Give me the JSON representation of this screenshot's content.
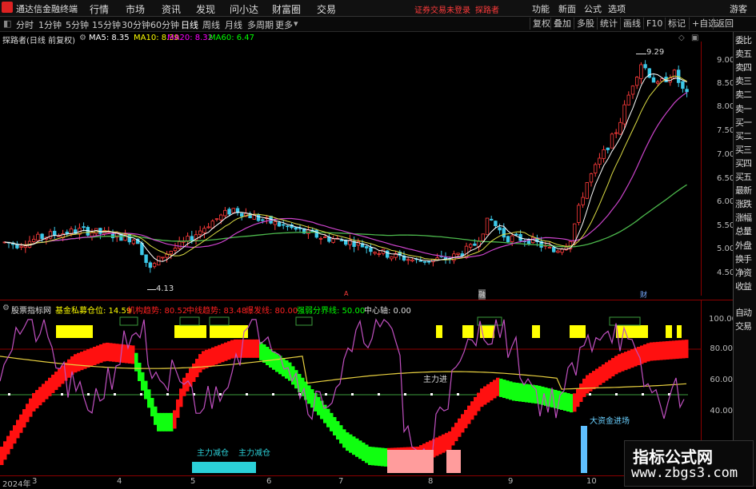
{
  "titlebar": {
    "app_title": "通达信金融终端",
    "menus": [
      "行情",
      "市场",
      "资讯",
      "发现",
      "问小达",
      "财富圈",
      "交易"
    ],
    "notice": "证券交易未登录",
    "user": "探路者",
    "right_buttons": [
      "功能",
      "新面",
      "公式",
      "选项",
      "游客"
    ]
  },
  "toolbar": {
    "periods": [
      "分时",
      "1分钟",
      "5分钟",
      "15分钟",
      "30分钟",
      "60分钟",
      "日线",
      "周线",
      "月线",
      "多周期",
      "更多"
    ],
    "active_period": "日线",
    "tools": [
      "复权",
      "叠加",
      "多股",
      "统计",
      "画线",
      "F10",
      "标记",
      "+自选",
      "返回"
    ]
  },
  "main_chart": {
    "stock_title": "探路者(日线 前复权)",
    "ma": [
      {
        "label": "MA5: 8.35",
        "color": "#ffffff"
      },
      {
        "label": "MA10: 8.39",
        "color": "#ffff00"
      },
      {
        "label": "MA20: 8.32",
        "color": "#ff00ff"
      },
      {
        "label": "MA60: 6.47",
        "color": "#00ff00"
      }
    ],
    "y_ticks": [
      "9.00",
      "8.50",
      "8.00",
      "7.50",
      "7.00",
      "6.50",
      "6.00",
      "5.50",
      "5.00",
      "4.50"
    ],
    "high_label": "9.29",
    "low_label": "4.13",
    "markers": [
      "融",
      "财"
    ]
  },
  "indicator": {
    "name": "股票指标网",
    "params": [
      {
        "label": "基金私募仓位: 14.59",
        "color": "#ffff00"
      },
      {
        "label": "机构趋势: 80.52",
        "color": "#ff2020"
      },
      {
        "label": "中线趋势: 83.48",
        "color": "#ff2020"
      },
      {
        "label": "爆发线: 80.00",
        "color": "#ff2020"
      },
      {
        "label": "强弱分界线: 50.00",
        "color": "#00ff00"
      },
      {
        "label": "中心轴: 0.00",
        "color": "#dddddd"
      }
    ],
    "y_ticks": [
      "100.00",
      "80.00",
      "60.00",
      "40.00"
    ],
    "annotations": [
      "主力进",
      "主力减仓",
      "主力减仓",
      "大资金进场"
    ]
  },
  "x_axis": [
    "2024年",
    "3",
    "4",
    "5",
    "6",
    "7",
    "8",
    "9",
    "10"
  ],
  "right_panel": [
    "委比",
    "卖五",
    "卖四",
    "卖三",
    "卖二",
    "卖一",
    "买一",
    "买二",
    "买三",
    "买四",
    "买五",
    "最新",
    "涨跌",
    "涨幅",
    "总量",
    "外盘",
    "换手",
    "净资",
    "收益"
  ],
  "right_panel_bottom": [
    "自动",
    "交易"
  ],
  "watermark": {
    "title": "指标公式网",
    "url": "www.zbgs3.com"
  }
}
